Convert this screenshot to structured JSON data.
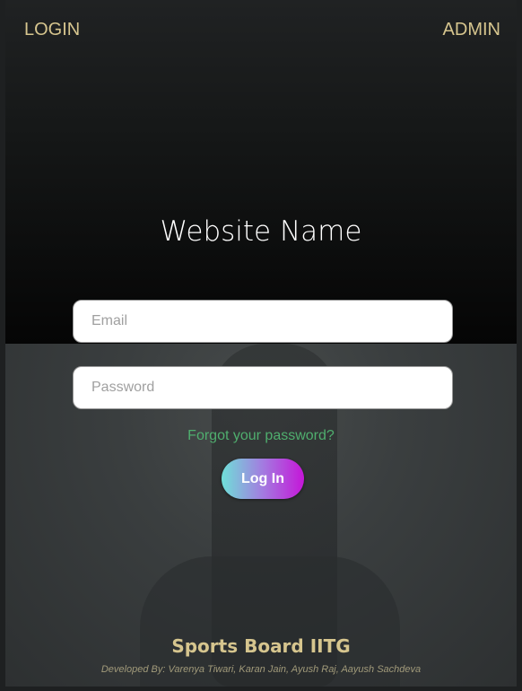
{
  "nav": {
    "login": "LOGIN",
    "admin": "ADMIN"
  },
  "title": "Website Name",
  "form": {
    "email_placeholder": "Email",
    "password_placeholder": "Password",
    "forgot_link": "Forgot your password?",
    "login_button": "Log In"
  },
  "footer": {
    "brand": "Sports Board IITG",
    "credits": "Developed By: Varenya Tiwari, Karan Jain, Ayush Raj, Aayush Sachdeva"
  },
  "colors": {
    "accent_gold": "#d6c58e",
    "link_green": "#4fae6e",
    "button_start": "#6fe0d8",
    "button_end": "#c516d8"
  }
}
